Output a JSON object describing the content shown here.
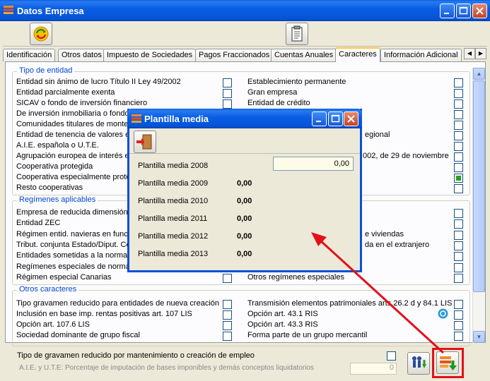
{
  "window": {
    "title": "Datos Empresa"
  },
  "tabs": [
    "Identificación",
    "Otros datos",
    "Impuesto de Sociedades",
    "Pagos Fraccionados",
    "Cuentas Anuales",
    "Caracteres",
    "Información Adicional"
  ],
  "active_tab": "Caracteres",
  "groups": {
    "tipo_entidad": {
      "legend": "Tipo de entidad",
      "left": [
        "Entidad sin ánimo de lucro Título II Ley 49/2002",
        "Entidad parcialmente exenta",
        "SICAV o fondo de inversión financiero",
        "De inversión inmobiliaria o fondo d",
        "Comunidades titulares de montes",
        "Entidad de tenencia de valores e",
        "A.I.E. española o U.T.E.",
        "Agrupación europea de interés ec",
        "Cooperativa protegida",
        "Cooperativa especialmente proteg",
        "Resto cooperativas"
      ],
      "right": [
        "Establecimiento permanente",
        "Gran empresa",
        "Entidad de crédito",
        "",
        "",
        "egional",
        "",
        "002, de 29 de noviembre",
        "",
        "",
        ""
      ]
    },
    "regimenes": {
      "legend": "Regímenes aplicables",
      "left": [
        "Empresa de reducida dimensión",
        "Entidad ZEC",
        "Régimen entid. navieras en funcic",
        "Tribut. conjunta Estado/Diput. Co",
        "Entidades sometidas a la normativ",
        "Regímenes especiales de normal",
        "Régimen especial Canarias"
      ],
      "right": [
        "",
        "",
        "e viviendas",
        "da en el extranjero",
        "",
        "",
        "Otros regímenes especiales"
      ]
    },
    "otros": {
      "legend": "Otros caracteres",
      "left": [
        "Tipo gravamen reducido para entidades de nueva creación",
        "Inclusión en base imp. rentas positivas art. 107 LIS",
        "Opción art. 107.6 LIS",
        "Sociedad dominante de grupo fiscal"
      ],
      "right": [
        "Transmisión elementos patrimoniales arts.26.2 d y 84.1 LIS",
        "Opción art. 43.1 RIS",
        "Opción art. 43.3 RIS",
        "Forma parte de un grupo mercantil"
      ]
    }
  },
  "bottom": {
    "checkbox_label": "Tipo de gravamen reducido por mantenimiento o creación de empleo",
    "field_label": "A.I.E. y U.T.E: Porcentaje de imputación de bases imponibles y demás conceptos liquidatorios",
    "field_value": "0"
  },
  "modal": {
    "title": "Plantilla media",
    "input_value": "0,00",
    "rows": [
      {
        "label": "Plantilla media 2008",
        "value": ""
      },
      {
        "label": "Plantilla media 2009",
        "value": "0,00"
      },
      {
        "label": "Plantilla media 2010",
        "value": "0,00"
      },
      {
        "label": "Plantilla media 2011",
        "value": "0,00"
      },
      {
        "label": "Plantilla media 2012",
        "value": "0,00"
      },
      {
        "label": "Plantilla media 2013",
        "value": "0,00"
      }
    ]
  },
  "colors": {
    "title_bar": "#0a5de4",
    "legend": "#0046d5",
    "highlight": "#e3101a",
    "input_bg": "#fefce8"
  }
}
